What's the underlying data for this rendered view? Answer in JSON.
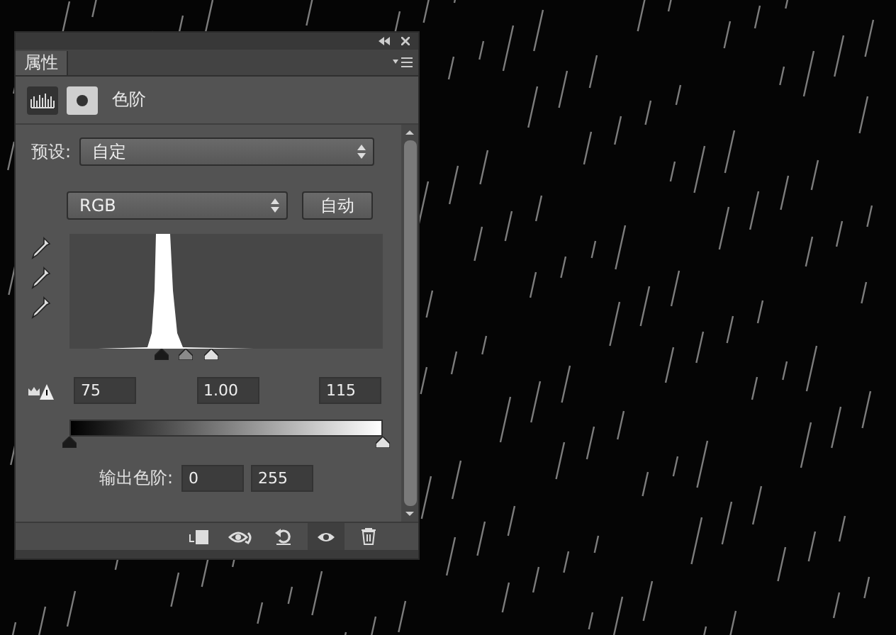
{
  "panel": {
    "tab": {
      "label": "属性",
      "selected": true
    },
    "adjustment_title": "色阶",
    "preset": {
      "label": "预设:",
      "value": "自定"
    },
    "channel": {
      "value": "RGB"
    },
    "auto_button": "自动",
    "input_sliders": [
      {
        "kind": "black",
        "level": 0.294
      },
      {
        "kind": "gray",
        "level": 0.37
      },
      {
        "kind": "white",
        "level": 0.451
      }
    ],
    "input_levels": [
      "75",
      "1.00",
      "115"
    ],
    "output_sliders": [
      {
        "kind": "black",
        "level": 0
      },
      {
        "kind": "white",
        "level": 1
      }
    ],
    "output": {
      "label": "输出色阶:",
      "values": [
        "0",
        "255"
      ]
    },
    "toolbar": [
      {
        "kind": "clip",
        "selected": false
      },
      {
        "kind": "view-previous",
        "selected": false
      },
      {
        "kind": "reset",
        "selected": false
      },
      {
        "kind": "visibility",
        "selected": true
      },
      {
        "kind": "delete",
        "selected": false
      }
    ]
  }
}
